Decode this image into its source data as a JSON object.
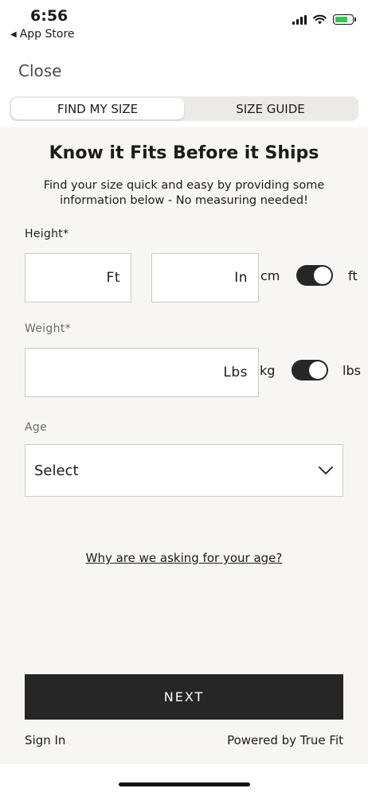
{
  "status_bar": {
    "time": "6:56",
    "back_app": "App Store",
    "battery_color": "#32c759"
  },
  "header": {
    "close_label": "Close"
  },
  "tabs": [
    {
      "label": "FIND MY SIZE",
      "active": true
    },
    {
      "label": "SIZE GUIDE",
      "active": false
    }
  ],
  "form": {
    "title": "Know it Fits Before it Ships",
    "subtitle": "Find your size quick and easy by providing some information below - No measuring needed!",
    "height": {
      "label": "Height*",
      "feet_unit": "Ft",
      "inches_unit": "In",
      "toggle_left": "cm",
      "toggle_right": "ft",
      "toggle_selected": "ft"
    },
    "weight": {
      "label": "Weight*",
      "unit": "Lbs",
      "toggle_left": "kg",
      "toggle_right": "lbs",
      "toggle_selected": "lbs"
    },
    "age": {
      "label": "Age",
      "selected": "Select"
    },
    "why_link": "Why are we asking for your age?"
  },
  "footer": {
    "next_label": "NEXT",
    "sign_in": "Sign In",
    "powered_by": "Powered by True Fit"
  },
  "icons": [
    "back-triangle-icon",
    "signal-icon",
    "wifi-icon",
    "battery-charging-icon",
    "chevron-down-icon"
  ]
}
